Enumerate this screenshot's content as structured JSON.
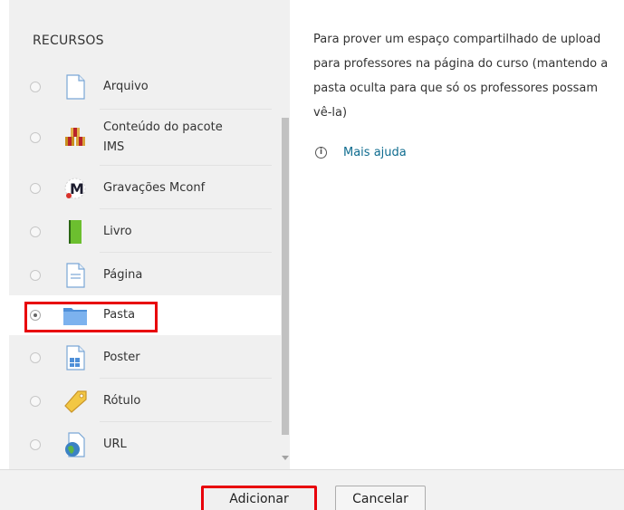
{
  "section_title": "RECURSOS",
  "items": [
    {
      "label": "Arquivo",
      "icon": "file-icon",
      "selected": false
    },
    {
      "label": "Conteúdo do pacote",
      "label2": "IMS",
      "icon": "ims-package-icon",
      "selected": false
    },
    {
      "label": "Gravações Mconf",
      "icon": "mconf-icon",
      "selected": false
    },
    {
      "label": "Livro",
      "icon": "book-icon",
      "selected": false
    },
    {
      "label": "Página",
      "icon": "page-icon",
      "selected": false
    },
    {
      "label": "Pasta",
      "icon": "folder-icon",
      "selected": true
    },
    {
      "label": "Poster",
      "icon": "poster-icon",
      "selected": false
    },
    {
      "label": "Rótulo",
      "icon": "label-tag-icon",
      "selected": false
    },
    {
      "label": "URL",
      "icon": "globe-icon",
      "selected": false
    }
  ],
  "description": "Para prover um espaço compartilhado de upload para professores na página do curso (mantendo a pasta oculta para que só os professores possam vê-la)",
  "help_link": "Mais ajuda",
  "buttons": {
    "add": "Adicionar",
    "cancel": "Cancelar"
  },
  "colors": {
    "highlight": "#e8000b",
    "link": "#0f6c8f",
    "folder": "#6aa6e8"
  }
}
